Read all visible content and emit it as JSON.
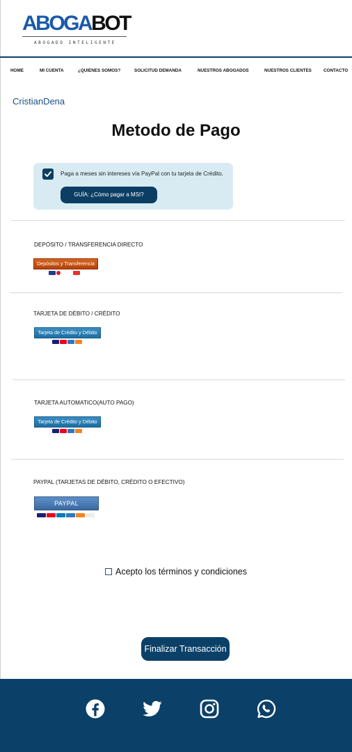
{
  "header": {
    "logo_part1": "ABOGA",
    "logo_part2": "BOT",
    "tagline": "ABOGADO INTELIGENTE"
  },
  "nav": {
    "items": [
      {
        "label": "HOME"
      },
      {
        "label": "MI CUENTA"
      },
      {
        "label": "¿QUIENES SOMOS?"
      },
      {
        "label": "SOLICITUD DEMANDA"
      },
      {
        "label": "NUESTROS ABOGADOS"
      },
      {
        "label": "NUESTROS CLIENTES"
      },
      {
        "label": "CONTACTO"
      }
    ]
  },
  "user": {
    "name": "CristianDena"
  },
  "page": {
    "title": "Metodo de Pago"
  },
  "msi": {
    "checked": true,
    "text": "Paga a meses sin intereses vía PayPal con tu tarjeta de Crédito.",
    "guide_label": "GUÍA: ¿Cómo pagar a MSI?"
  },
  "methods": {
    "deposit": {
      "label": "DEPÓSITO / TRANSFERENCIA DIRECTO",
      "button": "Depósitos y Transferencia"
    },
    "debit_credit": {
      "label": "TARJETA DE DÉBITO / CRÉDITO",
      "button": "Tarjeta de Crédito y Débito"
    },
    "auto": {
      "label": "TARJETA AUTOMATICO(AUTO PAGO)",
      "button": "Tarjeta de Crédito y Débito"
    },
    "paypal": {
      "label": "PAYPAL (TARJETAS DE DÉBITO, CRÉDITO O EFECTIVO)",
      "button": "PAYPAL"
    }
  },
  "terms": {
    "checked": false,
    "label": "Acepto los términos y  condiciones"
  },
  "actions": {
    "finish_label": "Finalizar Transacción"
  },
  "footer": {
    "social": [
      "facebook-icon",
      "twitter-icon",
      "instagram-icon",
      "whatsapp-icon"
    ]
  },
  "colors": {
    "primary": "#0b4068",
    "accent_blue": "#1d4f86",
    "msi_bg": "#d8ebf3",
    "deposit_orange": "#c8531a",
    "card_blue": "#2a7db5",
    "paypal_blue": "#4a7ab4"
  }
}
